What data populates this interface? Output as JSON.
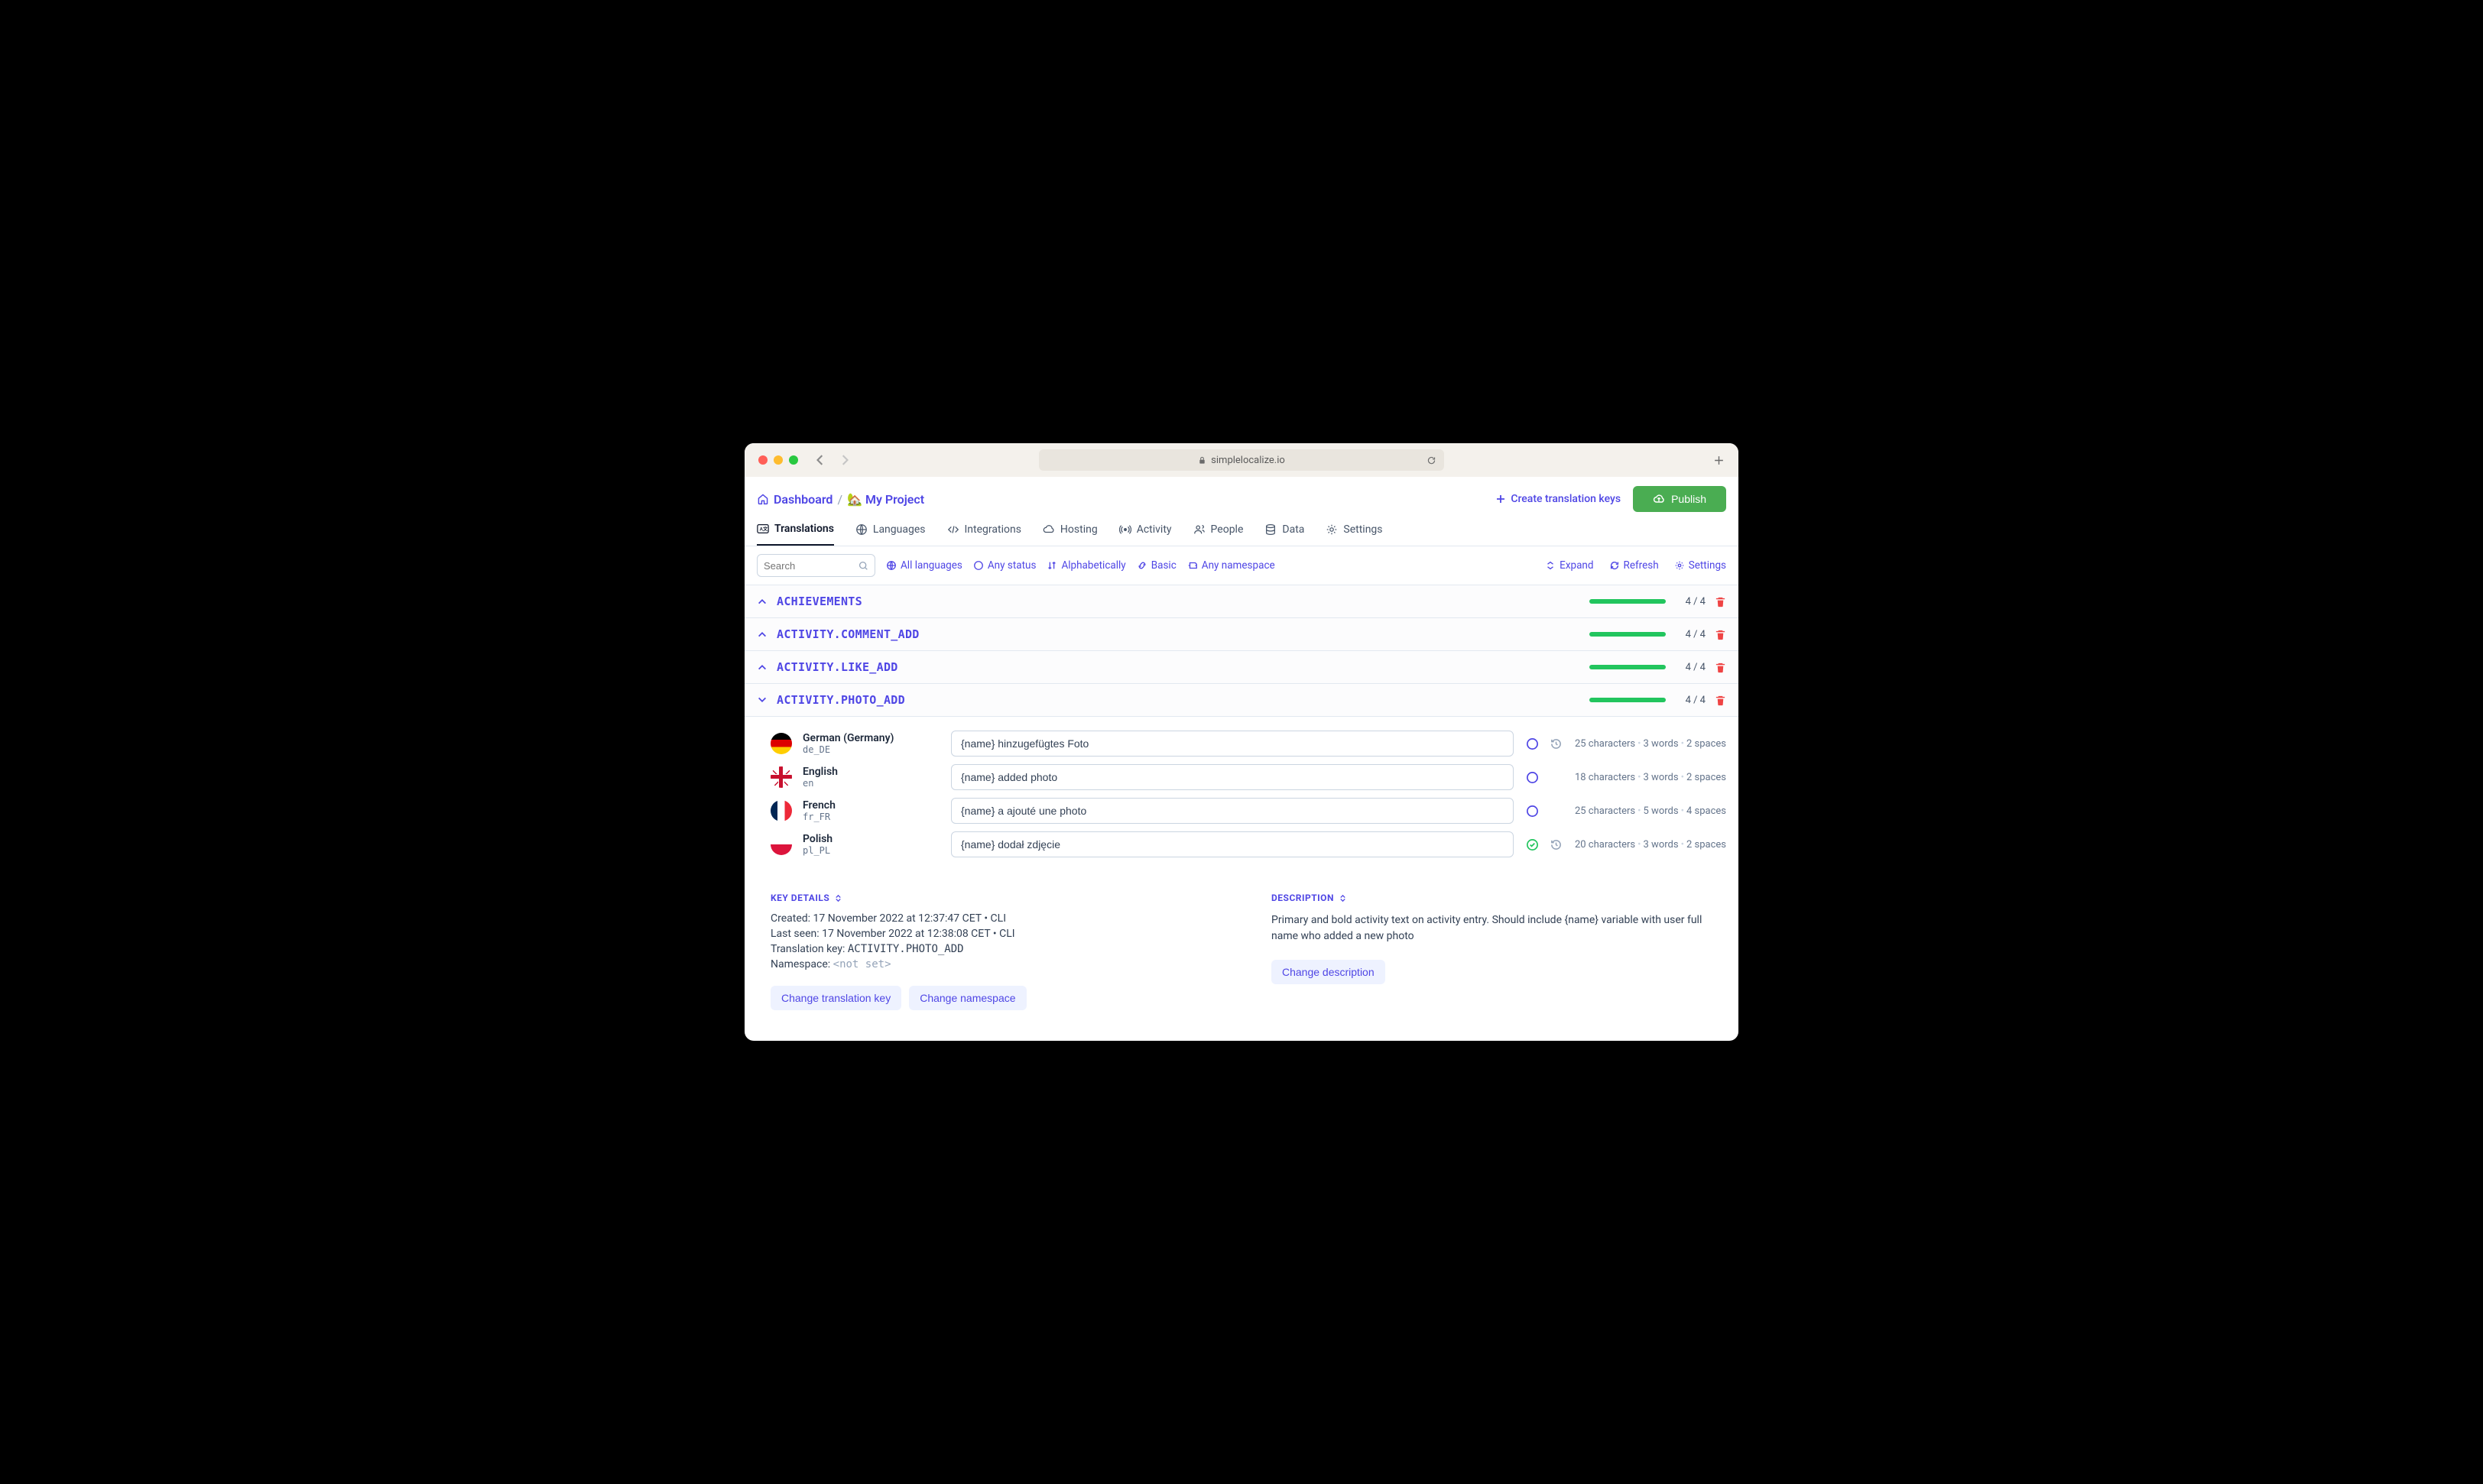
{
  "browser": {
    "url": "simplelocalize.io"
  },
  "breadcrumb": {
    "dashboard": "Dashboard",
    "project": "🏡 My Project"
  },
  "actions": {
    "create": "Create translation keys",
    "publish": "Publish"
  },
  "tabs": [
    {
      "label": "Translations"
    },
    {
      "label": "Languages"
    },
    {
      "label": "Integrations"
    },
    {
      "label": "Hosting"
    },
    {
      "label": "Activity"
    },
    {
      "label": "People"
    },
    {
      "label": "Data"
    },
    {
      "label": "Settings"
    }
  ],
  "search": {
    "placeholder": "Search"
  },
  "filters": {
    "languages": "All languages",
    "status": "Any status",
    "sort": "Alphabetically",
    "view": "Basic",
    "namespace": "Any namespace",
    "expand": "Expand",
    "refresh": "Refresh",
    "settings": "Settings"
  },
  "keys": [
    {
      "name": "ACHIEVEMENTS",
      "progress": 100,
      "count": "4 / 4",
      "expanded": false
    },
    {
      "name": "ACTIVITY.COMMENT_ADD",
      "progress": 100,
      "count": "4 / 4",
      "expanded": false
    },
    {
      "name": "ACTIVITY.LIKE_ADD",
      "progress": 100,
      "count": "4 / 4",
      "expanded": false
    },
    {
      "name": "ACTIVITY.PHOTO_ADD",
      "progress": 100,
      "count": "4 / 4",
      "expanded": true
    }
  ],
  "translations": [
    {
      "lang": "German (Germany)",
      "code": "de_DE",
      "flag": "de",
      "value": "{name} hinzugefügtes Foto",
      "stats_chars": "25 characters",
      "stats_words": "3 words",
      "stats_spaces": "2 spaces",
      "verified": false,
      "history": true
    },
    {
      "lang": "English",
      "code": "en",
      "flag": "en",
      "value": "{name} added photo",
      "stats_chars": "18 characters",
      "stats_words": "3 words",
      "stats_spaces": "2 spaces",
      "verified": false,
      "history": false
    },
    {
      "lang": "French",
      "code": "fr_FR",
      "flag": "fr",
      "value": "{name} a ajouté une photo",
      "stats_chars": "25 characters",
      "stats_words": "5 words",
      "stats_spaces": "4 spaces",
      "verified": false,
      "history": false
    },
    {
      "lang": "Polish",
      "code": "pl_PL",
      "flag": "pl",
      "value": "{name} dodał zdjęcie",
      "stats_chars": "20 characters",
      "stats_words": "3 words",
      "stats_spaces": "2 spaces",
      "verified": true,
      "history": true
    }
  ],
  "keyDetails": {
    "heading": "KEY DETAILS",
    "created_label": "Created:",
    "created": "17 November 2022 at 12:37:47 CET  •  CLI",
    "seen_label": "Last seen:",
    "seen": "17 November 2022 at 12:38:08 CET  •  CLI",
    "key_label": "Translation key:",
    "key": "ACTIVITY.PHOTO_ADD",
    "ns_label": "Namespace:",
    "ns": "<not set>",
    "btn_change_key": "Change translation key",
    "btn_change_ns": "Change namespace"
  },
  "description": {
    "heading": "DESCRIPTION",
    "text": "Primary and bold activity text on activity entry. Should include {name} variable with user full name who added a new photo",
    "btn_change": "Change description"
  }
}
